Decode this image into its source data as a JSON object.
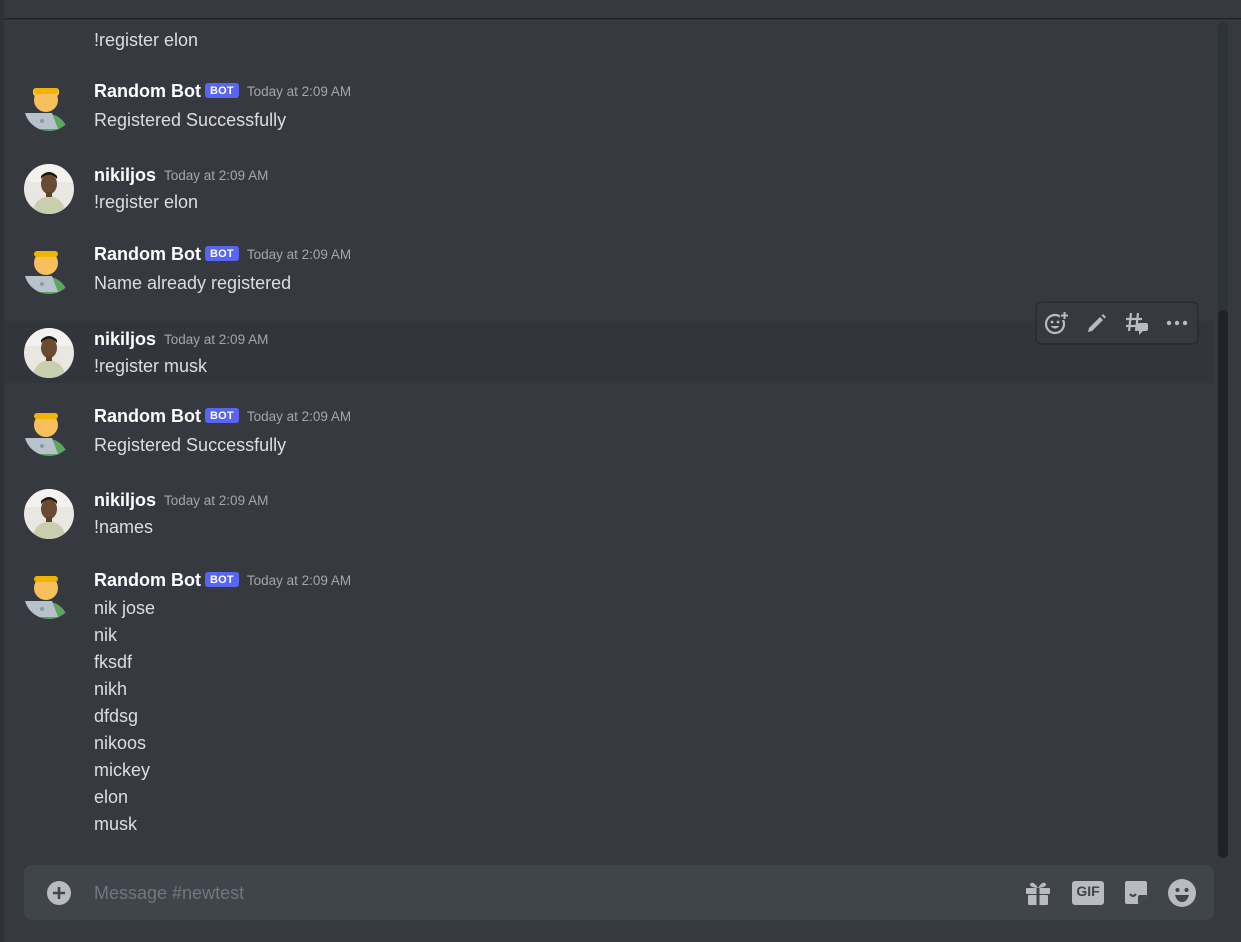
{
  "channel": {
    "name": "newtest"
  },
  "messages": [
    {
      "author": "",
      "is_bot": false,
      "timestamp": "",
      "lines": [
        "!register elon"
      ],
      "continuation": true
    },
    {
      "author": "Random Bot",
      "is_bot": true,
      "bot_tag": "BOT",
      "timestamp": "Today at 2:09 AM",
      "lines": [
        "Registered Successfully"
      ]
    },
    {
      "author": "nikiljos",
      "is_bot": false,
      "timestamp": "Today at 2:09 AM",
      "lines": [
        "!register elon"
      ]
    },
    {
      "author": "Random Bot",
      "is_bot": true,
      "bot_tag": "BOT",
      "timestamp": "Today at 2:09 AM",
      "lines": [
        "Name already registered"
      ]
    },
    {
      "author": "nikiljos",
      "is_bot": false,
      "timestamp": "Today at 2:09 AM",
      "lines": [
        "!register musk"
      ],
      "hovered": true
    },
    {
      "author": "Random Bot",
      "is_bot": true,
      "bot_tag": "BOT",
      "timestamp": "Today at 2:09 AM",
      "lines": [
        "Registered Successfully"
      ]
    },
    {
      "author": "nikiljos",
      "is_bot": false,
      "timestamp": "Today at 2:09 AM",
      "lines": [
        "!names"
      ]
    },
    {
      "author": "Random Bot",
      "is_bot": true,
      "bot_tag": "BOT",
      "timestamp": "Today at 2:09 AM",
      "lines": [
        "nik jose",
        "nik",
        "fksdf",
        "nikh",
        "dfdsg",
        "nikoos",
        "mickey",
        "elon",
        "musk"
      ]
    }
  ],
  "message_actions": [
    {
      "icon": "add-reaction-icon"
    },
    {
      "icon": "edit-pencil-icon"
    },
    {
      "icon": "create-thread-icon"
    },
    {
      "icon": "more-options-icon"
    }
  ],
  "composer": {
    "placeholder": "Message #newtest",
    "value": "",
    "gif_label": "GIF",
    "icons": [
      "plus-circle-icon",
      "gift-icon",
      "gif-icon",
      "sticker-icon",
      "emoji-icon"
    ]
  },
  "colors": {
    "background": "#36393f",
    "composer": "#40444b",
    "bot_tag": "#5865f2",
    "username": "#ffffff",
    "message_text": "#dcddde",
    "timestamp": "#a3a6aa",
    "icon": "#b9bbbe"
  }
}
